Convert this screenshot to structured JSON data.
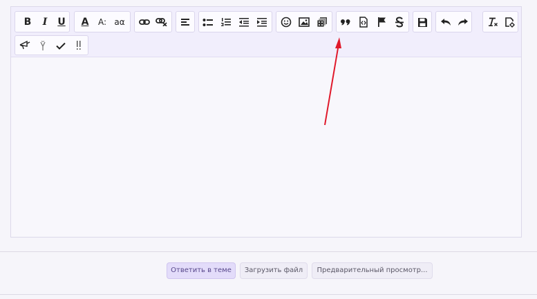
{
  "toolbar": {
    "row1": [
      [
        "bold-button",
        "B"
      ],
      [
        "italic-button",
        "I"
      ],
      [
        "underline-button",
        "U"
      ],
      [
        "font-color-button",
        "A"
      ],
      [
        "font-size-button",
        "A:"
      ],
      [
        "font-family-button",
        "aα"
      ]
    ]
  },
  "actions": {
    "reply": "Ответить в теме",
    "upload": "Загрузить файл",
    "preview": "Предварительный просмотр..."
  },
  "colors": {
    "accent": "#e3dcfa",
    "annotation": "#e0182a"
  }
}
